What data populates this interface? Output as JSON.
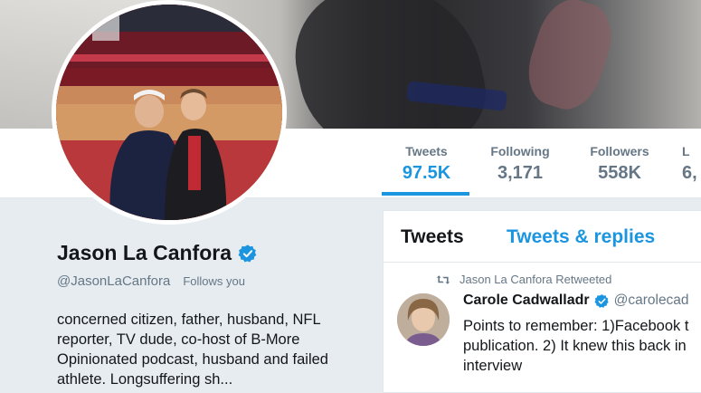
{
  "profile": {
    "name": "Jason La Canfora",
    "handle": "@JasonLaCanfora",
    "follows_you": "Follows you",
    "bio_lines": [
      "concerned citizen, father, husband, NFL",
      "reporter, TV dude, co-host of B-More",
      "Opinionated podcast, husband and failed",
      "athlete. Longsuffering sh..."
    ]
  },
  "stats": {
    "tweets": {
      "label": "Tweets",
      "value": "97.5K"
    },
    "following": {
      "label": "Following",
      "value": "3,171"
    },
    "followers": {
      "label": "Followers",
      "value": "558K"
    },
    "likes": {
      "label": "L",
      "value": "6,"
    }
  },
  "timeline": {
    "tabs": {
      "tweets": "Tweets",
      "replies": "Tweets & replies"
    },
    "retweet_note": "Jason La Canfora Retweeted",
    "tweet": {
      "author": "Carole Cadwalladr",
      "handle": "@carolecad",
      "lines": [
        "Points to remember: 1)Facebook t",
        "publication. 2) It knew this back in",
        "interview"
      ]
    }
  },
  "icons": {
    "verified": "verified-badge-icon",
    "retweet": "retweet-icon"
  },
  "colors": {
    "accent": "#1b95e0",
    "muted": "#657786",
    "background": "#e6ecf0"
  }
}
